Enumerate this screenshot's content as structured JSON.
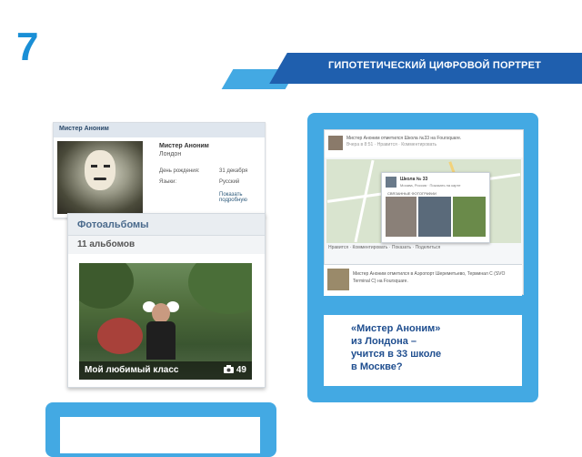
{
  "slide": {
    "number": "7"
  },
  "banner": {
    "title": "ГИПОТЕТИЧЕСКИЙ ЦИФРОВОЙ ПОРТРЕТ"
  },
  "profile": {
    "header": "Мистер Аноним",
    "name": "Мистер Аноним",
    "city": "Лондон",
    "birthday_label": "День рождения:",
    "birthday_value": "31 декабря",
    "language_label": "Языки:",
    "language_value": "Русский",
    "more_link": "Показать подробную"
  },
  "albums": {
    "title": "Фотоальбомы",
    "count_label": "11 альбомов",
    "album_caption": "Мой любимый класс",
    "album_photo_count": "49"
  },
  "foursquare": {
    "checkin1": "Мистер Аноним отметился Школа №33 на Foursquare.",
    "checkin1_meta": "Вчера в 8:51 · Нравится · Комментировать",
    "place_name": "Школа № 33",
    "place_address": "Москва, Россия · Показать на карте",
    "photos_label": "СВЯЗАННЫЕ ФОТОГРАФИИ",
    "links": "Нравится · Комментировать · Показать · Поделиться",
    "checkin2": "Мистер Аноним отметился в Аэропорт Шереметьево, Терминал С (SVO Terminal C) на Foursquare."
  },
  "quote": {
    "text": "«Мистер Аноним»\n из Лондона –\nучится в 33 школе\nв Москве?"
  },
  "colors": {
    "accent_light": "#43a9e3",
    "accent_dark": "#1f5fae",
    "slide_number": "#1a8fd6",
    "quote_text": "#1f4e8f"
  },
  "icons": {
    "camera": "camera-icon"
  }
}
